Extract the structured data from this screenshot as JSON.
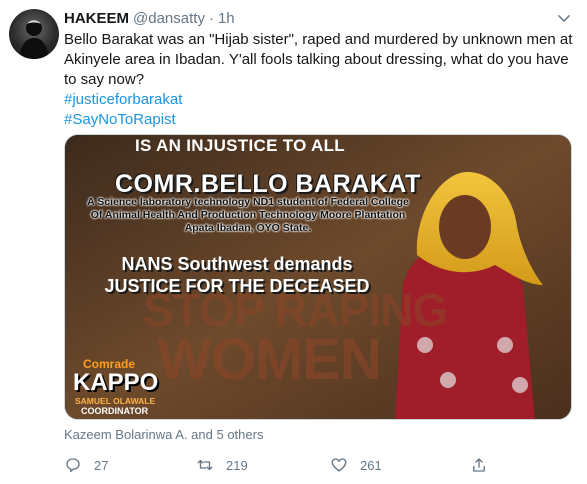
{
  "tweet": {
    "author_name": "HAKEEM",
    "handle": "@dansatty",
    "separator": "·",
    "time": "1h",
    "text": "Bello Barakat was an \"Hijab sister\", raped and murdered by unknown men at Akinyele area in Ibadan. Y'all fools talking about dressing, what do you have to say now?",
    "hashtags": [
      "#justiceforbarakat",
      "#SayNoToRapist"
    ],
    "social_context": "Kazeem Bolarinwa A. and 5 others",
    "actions": {
      "reply": {
        "icon": "reply-icon",
        "count": "27"
      },
      "retweet": {
        "icon": "retweet-icon",
        "count": "219"
      },
      "like": {
        "icon": "heart-icon",
        "count": "261"
      },
      "share": {
        "icon": "share-icon",
        "count": ""
      }
    },
    "more_icon": "chevron-down-icon"
  },
  "poster": {
    "headline": "IS AN INJUSTICE TO ALL",
    "name": "COMR.BELLO BARAKAT",
    "description": "A Science laboratory technology ND1 student of Federal College Of Animal Health And Production Technology Moore Plantation Apata Ibadan, OYO State.",
    "nans_line1": "NANS Southwest demands",
    "nans_line2": "JUSTICE FOR THE DECEASED",
    "stop_text": "STOP RAPING",
    "women_text": "WOMEN",
    "comrade": "Comrade",
    "kappo": "KAPPO",
    "samuel": "SAMUEL OLAWALE",
    "coordinator": "COORDINATOR"
  },
  "colors": {
    "link": "#1b95e0",
    "muted": "#657786",
    "text": "#14171a"
  }
}
